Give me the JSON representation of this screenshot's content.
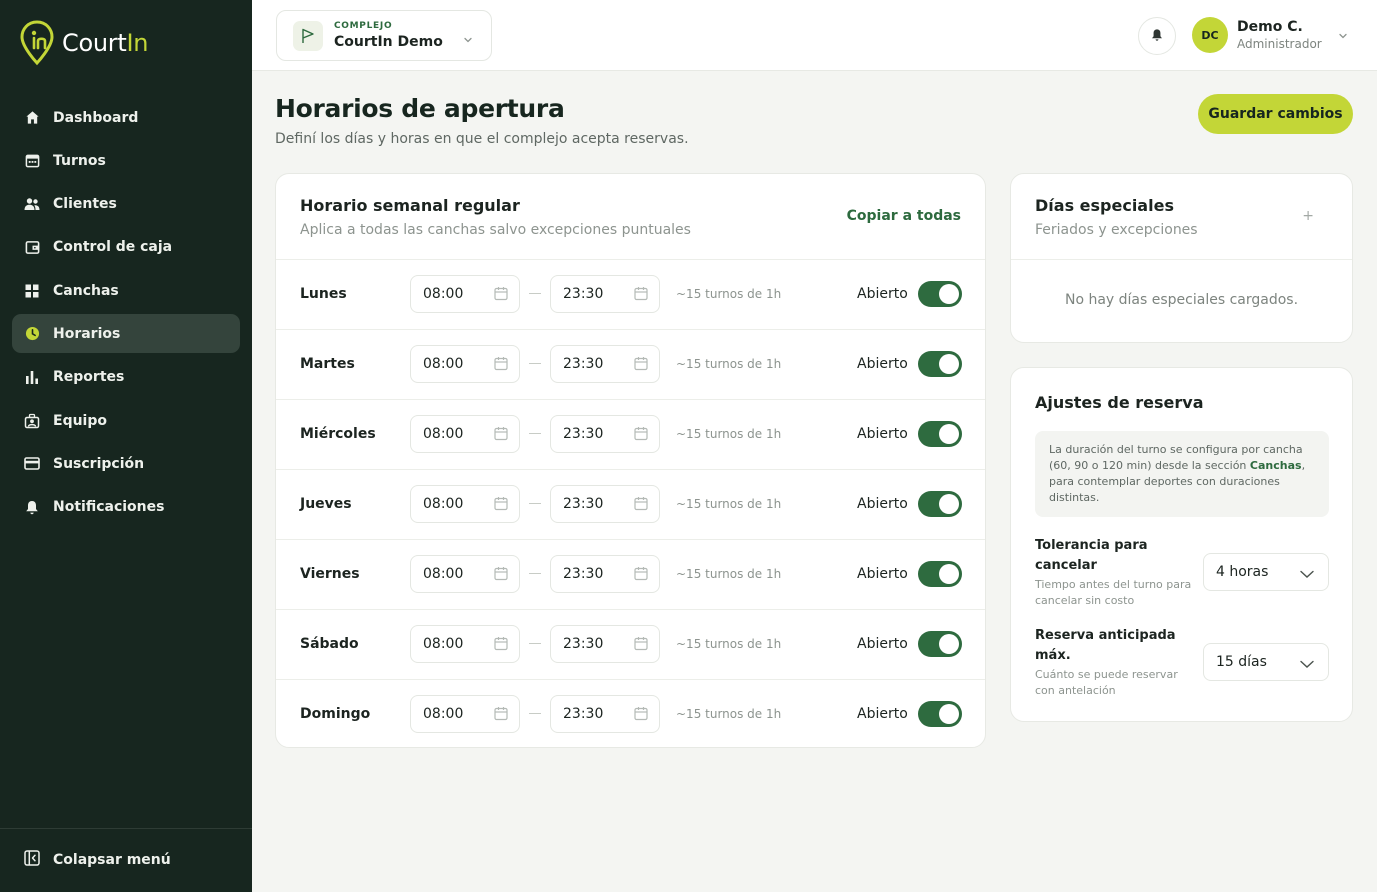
{
  "app": {
    "logo_name": "CourtIn",
    "logo_main": "Court",
    "logo_highlight": "In",
    "brand_color": "#c3d637",
    "sidebar_color": "#17261f",
    "toggle_color": "#2e6b3f"
  },
  "sidebar": {
    "items": [
      {
        "label": "Dashboard",
        "icon": "home-icon",
        "active": false
      },
      {
        "label": "Turnos",
        "icon": "calendar-icon",
        "active": false
      },
      {
        "label": "Clientes",
        "icon": "users-icon",
        "active": false
      },
      {
        "label": "Control de caja",
        "icon": "wallet-icon",
        "active": false
      },
      {
        "label": "Canchas",
        "icon": "grid-icon",
        "active": false
      },
      {
        "label": "Horarios",
        "icon": "clock-icon",
        "active": true
      },
      {
        "label": "Reportes",
        "icon": "bar-chart-icon",
        "active": false
      },
      {
        "label": "Equipo",
        "icon": "team-icon",
        "active": false
      },
      {
        "label": "Suscripción",
        "icon": "card-icon",
        "active": false
      },
      {
        "label": "Notificaciones",
        "icon": "bell-icon",
        "active": false
      }
    ],
    "collapse_label": "Colapsar menú"
  },
  "header": {
    "complex_label": "COMPLEJO",
    "complex_name": "CourtIn Demo",
    "user_initials": "DC",
    "user_name": "Demo C.",
    "user_role": "Administrador"
  },
  "page": {
    "title": "Horarios de apertura",
    "subtitle": "Definí los días y horas en que el complejo acepta reservas.",
    "save_label": "Guardar cambios"
  },
  "weekly": {
    "title": "Horario semanal regular",
    "subtitle": "Aplica a todas las canchas salvo excepciones puntuales",
    "copy_label": "Copiar a todas",
    "days": [
      {
        "name": "Lunes",
        "open": "08:00",
        "close": "23:30",
        "slots": "~15 turnos de 1h",
        "status": "Abierto",
        "enabled": true
      },
      {
        "name": "Martes",
        "open": "08:00",
        "close": "23:30",
        "slots": "~15 turnos de 1h",
        "status": "Abierto",
        "enabled": true
      },
      {
        "name": "Miércoles",
        "open": "08:00",
        "close": "23:30",
        "slots": "~15 turnos de 1h",
        "status": "Abierto",
        "enabled": true
      },
      {
        "name": "Jueves",
        "open": "08:00",
        "close": "23:30",
        "slots": "~15 turnos de 1h",
        "status": "Abierto",
        "enabled": true
      },
      {
        "name": "Viernes",
        "open": "08:00",
        "close": "23:30",
        "slots": "~15 turnos de 1h",
        "status": "Abierto",
        "enabled": true
      },
      {
        "name": "Sábado",
        "open": "08:00",
        "close": "23:30",
        "slots": "~15 turnos de 1h",
        "status": "Abierto",
        "enabled": true
      },
      {
        "name": "Domingo",
        "open": "08:00",
        "close": "23:30",
        "slots": "~15 turnos de 1h",
        "status": "Abierto",
        "enabled": true
      }
    ]
  },
  "special": {
    "title": "Días especiales",
    "subtitle": "Feriados y excepciones",
    "add_label": "+",
    "empty_text": "No hay días especiales cargados."
  },
  "booking": {
    "title": "Ajustes de reserva",
    "info_before": "La duración del turno se configura por cancha (60, 90 o 120 min) desde la sección",
    "info_link": "Canchas",
    "info_after": ", para contemplar deportes con duraciones distintas.",
    "cancel_title": "Tolerancia para cancelar",
    "cancel_desc": "Tiempo antes del turno para cancelar sin costo",
    "cancel_value": "4 horas",
    "advance_title": "Reserva anticipada máx.",
    "advance_desc": "Cuánto se puede reservar con antelación",
    "advance_value": "15 días"
  }
}
